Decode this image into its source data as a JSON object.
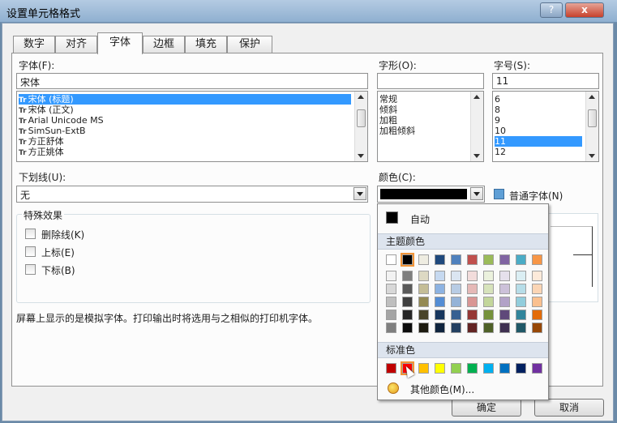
{
  "window": {
    "title": "设置单元格格式",
    "help": "?",
    "close": "x"
  },
  "tabs": [
    "数字",
    "对齐",
    "字体",
    "边框",
    "填充",
    "保护"
  ],
  "active_tab": "字体",
  "font": {
    "label": "字体(F):",
    "value": "宋体",
    "items": [
      {
        "text": "宋体 (标题)",
        "selected": true
      },
      {
        "text": "宋体 (正文)",
        "selected": false
      },
      {
        "text": "Arial Unicode MS",
        "selected": false
      },
      {
        "text": "SimSun-ExtB",
        "selected": false
      },
      {
        "text": "方正舒体",
        "selected": false
      },
      {
        "text": "方正姚体",
        "selected": false
      }
    ],
    "icon": "Tr"
  },
  "style": {
    "label": "字形(O):",
    "value": "",
    "items": [
      "常规",
      "倾斜",
      "加粗",
      "加粗倾斜"
    ]
  },
  "size": {
    "label": "字号(S):",
    "value": "11",
    "items": [
      {
        "text": "6",
        "selected": false
      },
      {
        "text": "8",
        "selected": false
      },
      {
        "text": "9",
        "selected": false
      },
      {
        "text": "10",
        "selected": false
      },
      {
        "text": "11",
        "selected": true
      },
      {
        "text": "12",
        "selected": false
      }
    ]
  },
  "underline": {
    "label": "下划线(U):",
    "value": "无"
  },
  "color": {
    "label": "颜色(C):",
    "current": "#000000"
  },
  "normal_font": {
    "label": "普通字体(N)",
    "checked": true
  },
  "effects": {
    "title": "特殊效果",
    "items": [
      "删除线(K)",
      "上标(E)",
      "下标(B)"
    ]
  },
  "note": "屏幕上显示的是模拟字体。打印输出时将选用与之相似的打印机字体。",
  "buttons": {
    "ok": "确定",
    "cancel": "取消"
  },
  "color_popup": {
    "auto_label": "自动",
    "theme_title": "主题颜色",
    "standard_title": "标准色",
    "more_label": "其他颜色(M)...",
    "theme_top": [
      "#ffffff",
      "#000000",
      "#eeece1",
      "#1f497d",
      "#4f81bd",
      "#c0504d",
      "#9bbb59",
      "#8064a2",
      "#4bacc6",
      "#f79646"
    ],
    "theme_shades": [
      [
        "#f2f2f2",
        "#7f7f7f",
        "#ddd9c3",
        "#c6d9f0",
        "#dbe5f1",
        "#f2dcdb",
        "#ebf1dd",
        "#e5e0ec",
        "#dbeef3",
        "#fdeada"
      ],
      [
        "#d8d8d8",
        "#595959",
        "#c4bd97",
        "#8db3e2",
        "#b8cce4",
        "#e5b9b7",
        "#d7e3bc",
        "#ccc1d9",
        "#b7dde8",
        "#fbd5b5"
      ],
      [
        "#bfbfbf",
        "#3f3f3f",
        "#938953",
        "#548dd4",
        "#95b3d7",
        "#d99694",
        "#c3d69b",
        "#b2a2c7",
        "#92cddc",
        "#fac08f"
      ],
      [
        "#a5a5a5",
        "#262626",
        "#494429",
        "#17365d",
        "#366092",
        "#953734",
        "#76923c",
        "#5f497a",
        "#31859b",
        "#e36c09"
      ],
      [
        "#7f7f7f",
        "#0c0c0c",
        "#1d1b10",
        "#0f243e",
        "#244061",
        "#632423",
        "#4f6128",
        "#3f3151",
        "#205867",
        "#974806"
      ]
    ],
    "standard": [
      "#c00000",
      "#ff0000",
      "#ffc000",
      "#ffff00",
      "#92d050",
      "#00b050",
      "#00b0f0",
      "#0070c0",
      "#002060",
      "#7030a0"
    ],
    "selected_theme_index": 1,
    "selected_standard_index": 1
  }
}
